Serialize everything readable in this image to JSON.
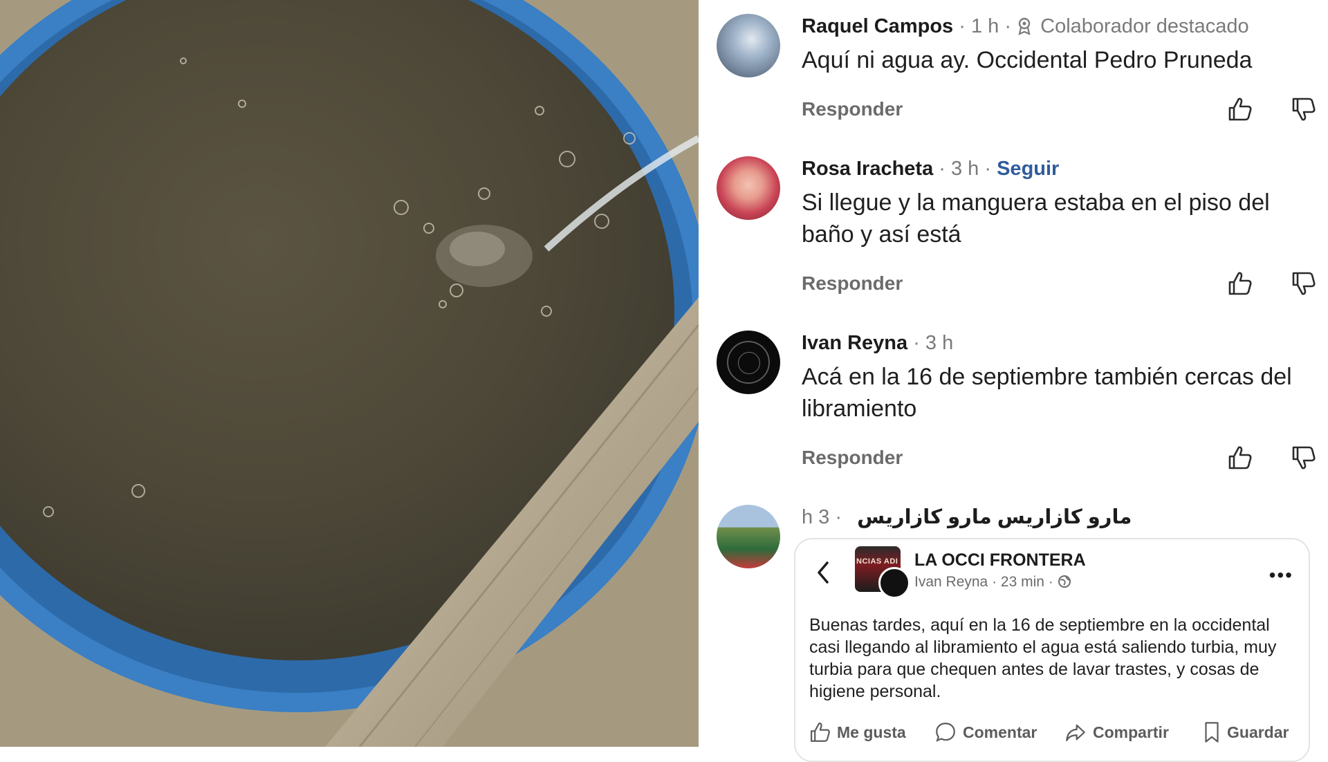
{
  "photo": {
    "alt": ""
  },
  "comments": [
    {
      "author": "Raquel Campos",
      "time": "1 h",
      "badge": "Colaborador destacado",
      "text": "Aquí ni agua ay. Occidental Pedro Pruneda",
      "reply_label": "Responder"
    },
    {
      "author": "Rosa Iracheta",
      "time": "3 h",
      "follow_label": "Seguir",
      "text": "Si llegue y la manguera estaba en el piso del baño y así está",
      "reply_label": "Responder"
    },
    {
      "author": "Ivan Reyna",
      "time": "3 h",
      "text": "Acá en la 16 de septiembre también cercas del libramiento",
      "reply_label": "Responder"
    },
    {
      "author": "مارو كازاريس  مارو كازاريس",
      "time": "h 3 ·",
      "shared_post": {
        "page_name": "LA OCCI FRONTERA",
        "logo_text": "NCIAS  ADI",
        "post_author": "Ivan Reyna",
        "post_time": "23 min",
        "text": "Buenas tardes, aquí en la 16 de septiembre en la occidental casi llegando al libramiento el agua está saliendo turbia, muy turbia para que chequen antes de lavar trastes, y cosas de higiene personal.",
        "actions": [
          "Me gusta",
          "Comentar",
          "Compartir",
          "Guardar"
        ]
      }
    }
  ],
  "colors": {
    "follow": "#2f5c9c",
    "text": "#1f1f1f",
    "muted": "#7a7a7a"
  },
  "icons": [
    "thumbs-up-icon",
    "thumbs-down-icon",
    "badge-icon",
    "back-arrow-icon",
    "globe-icon",
    "more-icon",
    "like-icon",
    "comment-icon",
    "share-icon",
    "bookmark-icon"
  ]
}
